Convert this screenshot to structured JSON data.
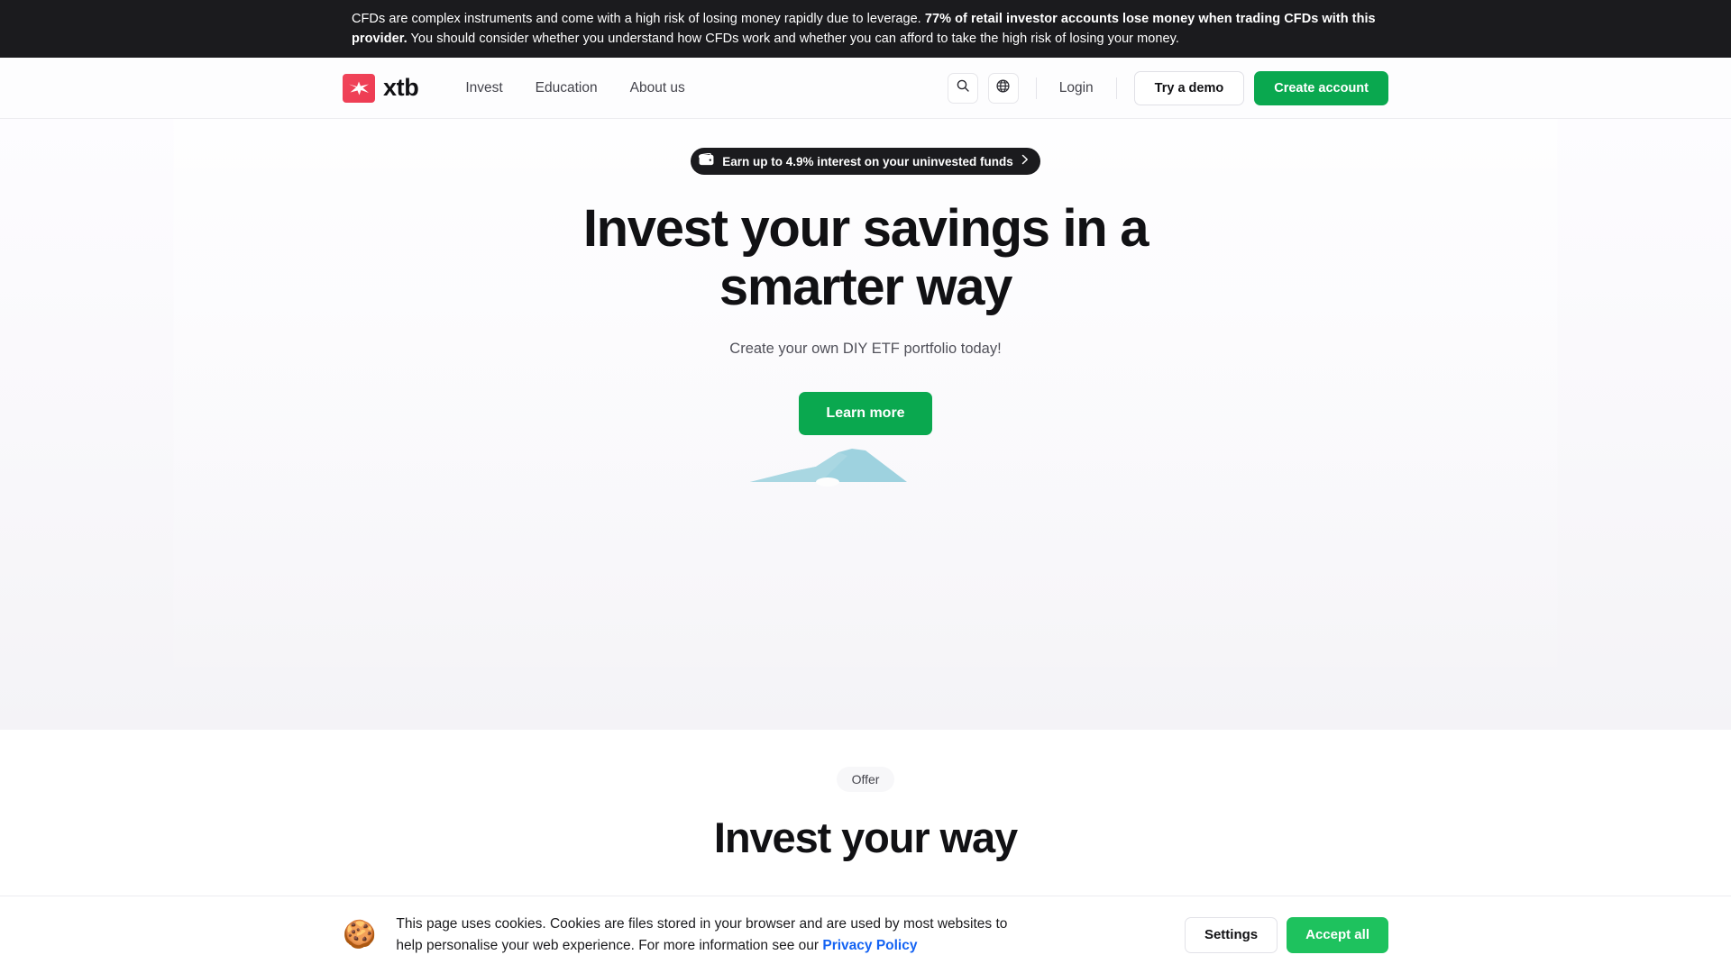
{
  "risk_banner": {
    "part1": "CFDs are complex instruments and come with a high risk of losing money rapidly due to leverage. ",
    "bold": "77% of retail investor accounts lose money when trading CFDs with this provider.",
    "part2": " You should consider whether you understand how CFDs work and whether you can afford to take the high risk of losing your money."
  },
  "header": {
    "logo_text": "xtb",
    "nav": [
      {
        "label": "Invest"
      },
      {
        "label": "Education"
      },
      {
        "label": "About us"
      }
    ],
    "search_icon": "search-icon",
    "language_icon": "globe-icon",
    "login_label": "Login",
    "demo_label": "Try a demo",
    "create_account_label": "Create account"
  },
  "hero": {
    "promo": {
      "icon": "wallet-icon",
      "text": "Earn up to 4.9% interest on your uninvested funds",
      "chevron": "chevron-right-icon"
    },
    "title": "Invest your savings in a smarter way",
    "subtitle": "Create your own DIY ETF portfolio today!",
    "cta_label": "Learn more",
    "graphic": "mountain-shape"
  },
  "offer": {
    "badge": "Offer",
    "title": "Invest your way"
  },
  "cookie_banner": {
    "icon": "cookie-icon",
    "text_before": "This page uses cookies. Cookies are files stored in your browser and are used by most websites to help personalise your web experience. For more information see our ",
    "link_label": "Privacy Policy",
    "settings_label": "Settings",
    "accept_label": "Accept all"
  },
  "colors": {
    "brand_red": "#ee3b52",
    "brand_green": "#0aa84f",
    "accept_green": "#1ec25e",
    "dark": "#1b1b1e",
    "link_blue": "#1463f3",
    "graphic_blue": "#9ed2df"
  }
}
